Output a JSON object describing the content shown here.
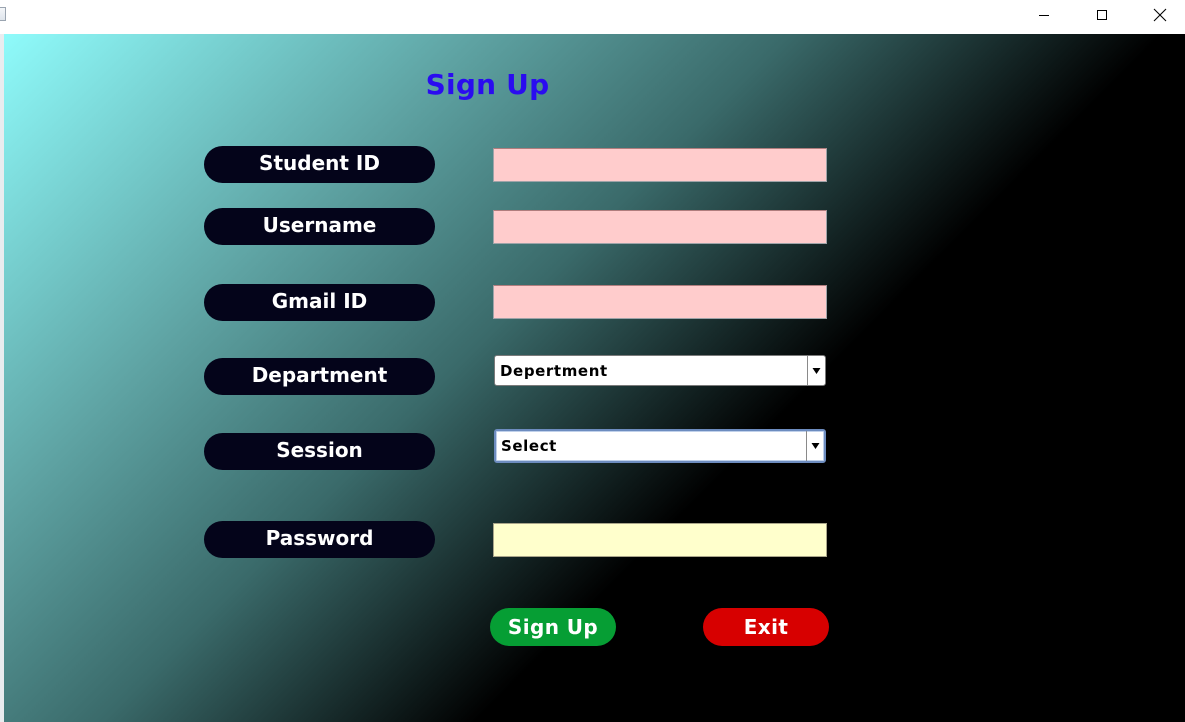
{
  "window": {
    "controls": [
      "minimize-icon",
      "maximize-icon",
      "close-icon"
    ]
  },
  "form": {
    "title": "Sign Up",
    "fields": {
      "student_id": {
        "label": "Student ID",
        "value": ""
      },
      "username": {
        "label": "Username",
        "value": ""
      },
      "gmail_id": {
        "label": "Gmail ID",
        "value": ""
      },
      "department": {
        "label": "Department",
        "selected": "Depertment"
      },
      "session": {
        "label": "Session",
        "selected": "Select"
      },
      "password": {
        "label": "Password",
        "value": ""
      }
    },
    "buttons": {
      "signup": "Sign Up",
      "exit": "Exit"
    }
  },
  "colors": {
    "title": "#2a0cf0",
    "label_bg": "#04041a",
    "text_field_bg": "#ffcccc",
    "password_field_bg": "#ffffcc",
    "signup_button": "#069e34",
    "exit_button": "#d70000",
    "gradient_start": "#8ffbfb",
    "gradient_end": "#000000"
  }
}
